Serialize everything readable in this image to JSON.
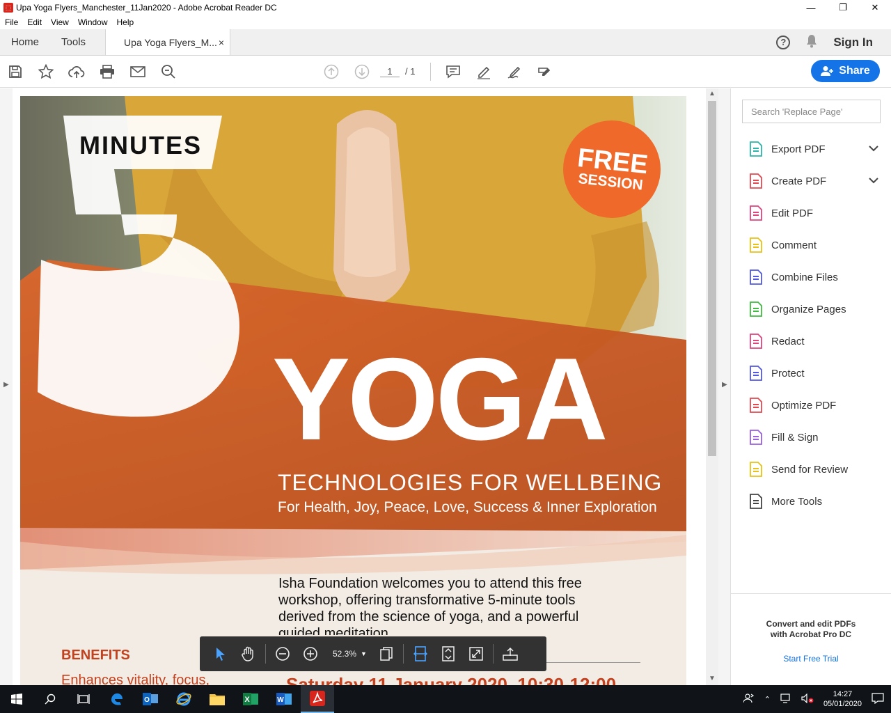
{
  "window": {
    "title": "Upa Yoga Flyers_Manchester_11Jan2020 - Adobe Acrobat Reader DC",
    "minimize": "—",
    "maximize": "❐",
    "close": "✕"
  },
  "menu": [
    "File",
    "Edit",
    "View",
    "Window",
    "Help"
  ],
  "tabs": {
    "home": "Home",
    "tools": "Tools",
    "doc": "Upa Yoga Flyers_M...",
    "doc_close": "×",
    "help": "?",
    "sign_in": "Sign In"
  },
  "toolbar": {
    "page_current": "1",
    "page_total": "/ 1",
    "share": "Share"
  },
  "flyer": {
    "minutes": "MINUTES",
    "five": "5",
    "free": "FREE",
    "session": "SESSION",
    "yoga": "YOGA",
    "technologies": "TECHNOLOGIES FOR WELLBEING",
    "tagline": "For Health, Joy, Peace, Love, Success & Inner Exploration",
    "welcome": "Isha Foundation welcomes you to attend this free workshop, offering transformative 5-minute tools derived from the science of yoga, and a powerful guided meditation.",
    "benefits": "BENEFITS",
    "benefit1": "Enhances vitality, focus,",
    "date": "Saturday 11 January 2020, 10:30-12:00"
  },
  "tools_pane": {
    "search_placeholder": "Search 'Replace Page'",
    "items": [
      {
        "label": "Export PDF",
        "icon": "export-pdf-icon",
        "color": "#2bb5a8",
        "chevron": "⌄"
      },
      {
        "label": "Create PDF",
        "icon": "create-pdf-icon",
        "color": "#e34850",
        "chevron": "⌄"
      },
      {
        "label": "Edit PDF",
        "icon": "edit-pdf-icon",
        "color": "#e0437e"
      },
      {
        "label": "Comment",
        "icon": "comment-icon",
        "color": "#e8c216"
      },
      {
        "label": "Combine Files",
        "icon": "combine-files-icon",
        "color": "#5258e4"
      },
      {
        "label": "Organize Pages",
        "icon": "organize-pages-icon",
        "color": "#3fbb3f"
      },
      {
        "label": "Redact",
        "icon": "redact-icon",
        "color": "#e0437e"
      },
      {
        "label": "Protect",
        "icon": "protect-icon",
        "color": "#5258e4"
      },
      {
        "label": "Optimize PDF",
        "icon": "optimize-pdf-icon",
        "color": "#e34850"
      },
      {
        "label": "Fill & Sign",
        "icon": "fill-sign-icon",
        "color": "#9b5fe0"
      },
      {
        "label": "Send for Review",
        "icon": "send-review-icon",
        "color": "#e8c216"
      },
      {
        "label": "More Tools",
        "icon": "more-tools-icon",
        "color": "#444444"
      }
    ],
    "promo_line1": "Convert and edit PDFs",
    "promo_line2": "with Acrobat Pro DC",
    "trial": "Start Free Trial"
  },
  "floating_toolbar": {
    "zoom": "52.3%"
  },
  "taskbar": {
    "time": "14:27",
    "date": "05/01/2020"
  },
  "colors": {
    "accent": "#1473e6",
    "flyer_orange": "#d9662c",
    "badge_orange": "#ef6a2a",
    "benefits_red": "#c2411e"
  }
}
